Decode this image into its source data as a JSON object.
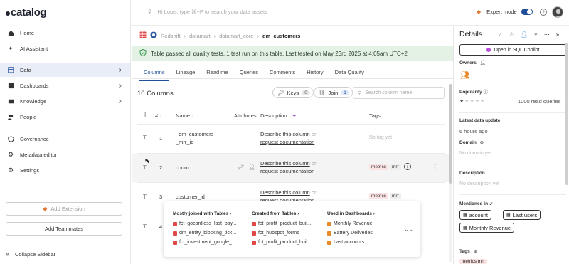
{
  "app": {
    "logo_text": "catalog"
  },
  "sidebar": {
    "items": [
      {
        "label": "Home",
        "icon": "home-icon"
      },
      {
        "label": "AI Assistant",
        "icon": "sparkle-icon"
      },
      {
        "label": "Data",
        "icon": "table-icon",
        "active": true
      },
      {
        "label": "Dashboards",
        "icon": "dashboard-icon"
      },
      {
        "label": "Knowledge",
        "icon": "book-icon"
      },
      {
        "label": "People",
        "icon": "people-icon"
      },
      {
        "label": "Governance",
        "icon": "shield-icon"
      },
      {
        "label": "Metadata editor",
        "icon": "gear-icon"
      },
      {
        "label": "Settings",
        "icon": "settings-icon"
      }
    ],
    "add_extension": "Add Extension",
    "add_teammates": "Add Teammates",
    "collapse": "Collapse Sidebar"
  },
  "topbar": {
    "search_placeholder": "Hi Louis, type ⌘+P to search your data assets",
    "expert_mode": "Expert mode",
    "help": "?"
  },
  "breadcrumb": {
    "items": [
      "Redshift",
      "datamart",
      "datamart_core"
    ],
    "current": "dm_customers"
  },
  "banner": {
    "text": "Table passed all quality tests. 1 test run on this table. Last tested on May 23rd 2025 at 4:05am UTC+2"
  },
  "tabs": [
    "Columns",
    "Lineage",
    "Read me",
    "Queries",
    "Comments",
    "History",
    "Data Quality"
  ],
  "toolbar": {
    "column_count": "10 Columns",
    "keys_label": "Keys",
    "keys_count": "0",
    "join_label": "Join",
    "join_count": "1",
    "search_placeholder": "Search column name"
  },
  "table": {
    "headers": {
      "num": "#",
      "name": "Name",
      "attributes": "Attributes",
      "description": "Description",
      "tags": "Tags"
    },
    "describe": "Describe this column",
    "or": "or",
    "request": "request documentation",
    "rows": [
      {
        "num": "1",
        "name_l1": "_dm_customers",
        "name_l2": "_mrr_id",
        "tags": [],
        "no_tag": "No tag yet"
      },
      {
        "num": "2",
        "name_l1": "churn",
        "name_l2": "",
        "tags": [
          "metrics",
          "mrr"
        ]
      },
      {
        "num": "3",
        "name_l1": "customer_id",
        "name_l2": "",
        "tags": [
          "metrics",
          "mrr"
        ]
      },
      {
        "num": "4"
      }
    ]
  },
  "popover": {
    "joined_header": "Mostly joined with Tables",
    "created_header": "Created from Tables",
    "dashboards_header": "Used in Dashboards",
    "joined": [
      "fct_gocardless_last_pay...",
      "dm_entity_blocking_tick...",
      "fct_investment_google_..."
    ],
    "created": [
      "fct_profit_product_buil...",
      "fct_hubspot_forms",
      "fct_profit_product_buil..."
    ],
    "dashboards": [
      "Monthly Revenue",
      "Battery Deliveries",
      "Last accounts"
    ]
  },
  "details": {
    "title": "Details",
    "open_sql": "Open in SQL Copilot",
    "owners": "Owners",
    "popularity": "Popularity",
    "read_queries": "1000 read queries",
    "latest_update_label": "Latest data update",
    "latest_update_value": "6 hours ago",
    "domain_label": "Domain",
    "domain_value": "No domain yet",
    "description_label": "Description",
    "description_value": "No description yet",
    "mentioned_label": "Mentioned in",
    "mentions": [
      "account",
      "Last users",
      "Monthly Revenue"
    ],
    "tags_label": "Tags",
    "tags_partial": "metrics mrr"
  },
  "colors": {
    "accent": "#1f4e9b",
    "banner_bg": "#e4f2e6",
    "tag_bg": "#fbe3e3",
    "active_nav": "#e8edf7"
  }
}
